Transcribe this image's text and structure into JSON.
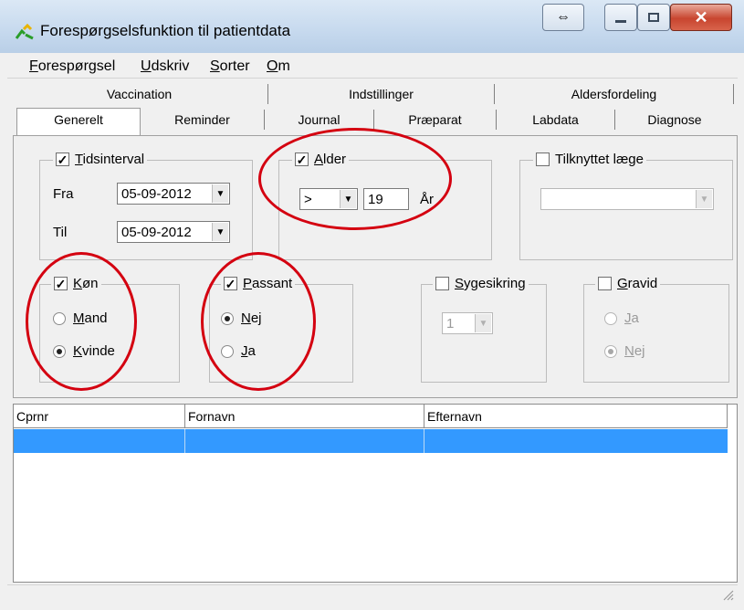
{
  "window": {
    "title": "Forespørgselsfunktion til patientdata"
  },
  "menu": [
    {
      "pre": "",
      "ul": "F",
      "rest": "orespørgsel"
    },
    {
      "pre": "",
      "ul": "U",
      "rest": "dskriv"
    },
    {
      "pre": "",
      "ul": "S",
      "rest": "orter"
    },
    {
      "pre": "",
      "ul": "O",
      "rest": "m"
    }
  ],
  "tabs": {
    "row1": [
      "Vaccination",
      "Indstillinger",
      "Aldersfordeling"
    ],
    "row2": [
      "Generelt",
      "Reminder",
      "Journal",
      "Præparat",
      "Labdata",
      "Diagnose"
    ],
    "active": "Generelt"
  },
  "tidsinterval": {
    "checked": "✓",
    "ul": "T",
    "rest": "idsinterval",
    "fra_label": "Fra",
    "fra_value": "05-09-2012",
    "til_label": "Til",
    "til_value": "05-09-2012"
  },
  "alder": {
    "checked": "✓",
    "ul": "A",
    "rest": "lder",
    "operator": ">",
    "value": "19",
    "unit": "År"
  },
  "tilknyttet": {
    "label": "Tilknyttet læge",
    "value": ""
  },
  "kon": {
    "checked": "✓",
    "ul": "K",
    "rest": "øn",
    "opt1_ul": "M",
    "opt1_rest": "and",
    "opt2_ul": "K",
    "opt2_rest": "vinde",
    "selected": "Kvinde"
  },
  "passant": {
    "checked": "✓",
    "ul": "P",
    "rest": "assant",
    "opt1_ul": "N",
    "opt1_rest": "ej",
    "opt2_ul": "J",
    "opt2_rest": "a",
    "selected": "Nej"
  },
  "sygesikring": {
    "ul": "S",
    "rest": "ygesikring",
    "value": "1"
  },
  "gravid": {
    "ul": "G",
    "rest": "ravid",
    "opt1_ul": "J",
    "opt1_rest": "a",
    "opt2_ul": "N",
    "opt2_rest": "ej",
    "selected": "Nej"
  },
  "grid": {
    "columns": [
      "Cprnr",
      "Fornavn",
      "Efternavn"
    ]
  },
  "colors": {
    "annotation": "#d40010",
    "selection": "#3399ff"
  }
}
